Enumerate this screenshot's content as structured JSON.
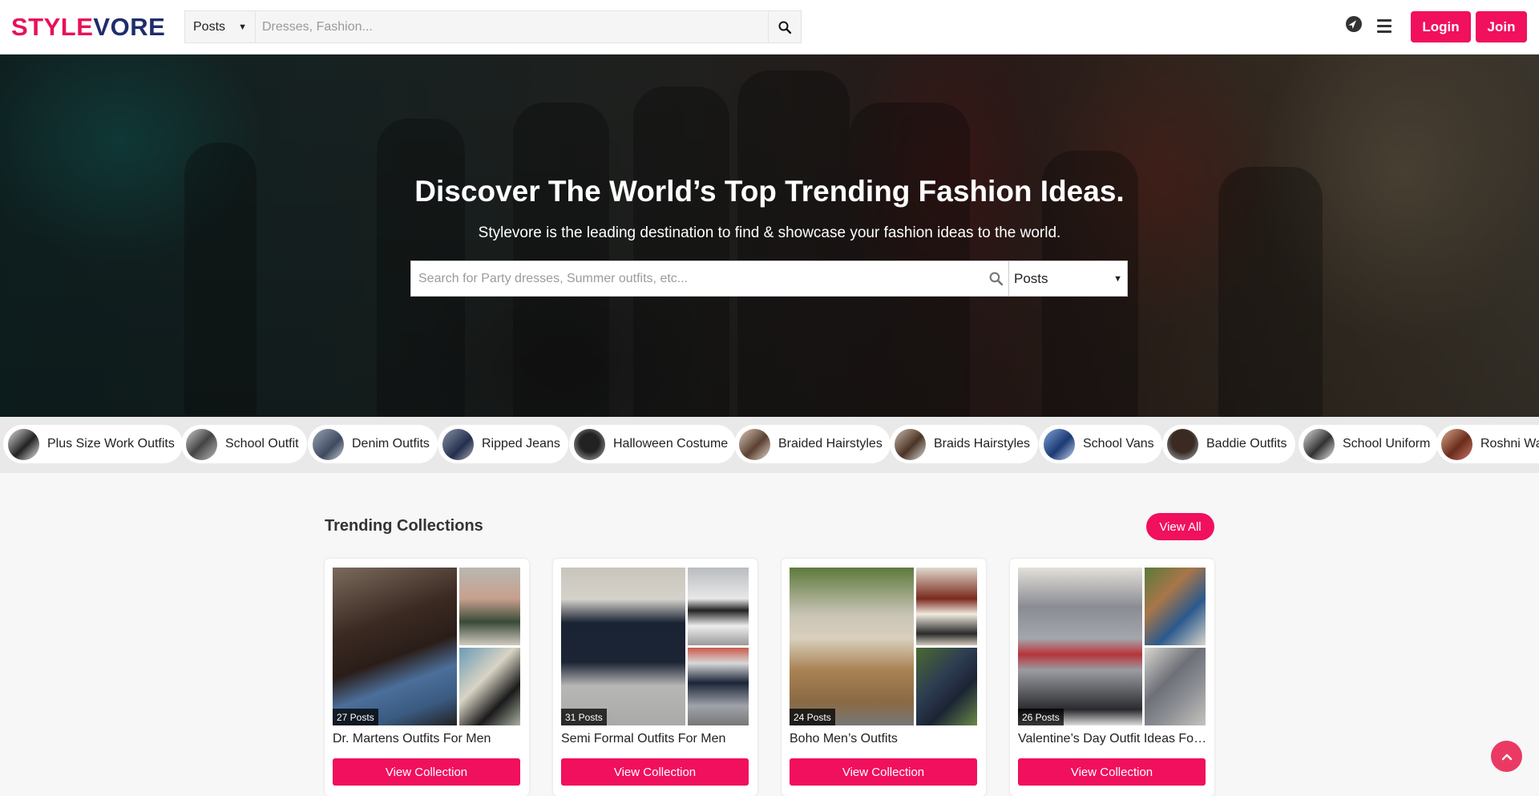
{
  "header": {
    "logo_part1": "STYLE",
    "logo_part2": "VORE",
    "search_type": "Posts",
    "search_placeholder": "Dresses, Fashion...",
    "login_label": "Login",
    "join_label": "Join",
    "icons": [
      "search-icon",
      "compass-icon",
      "hamburger-menu-icon"
    ]
  },
  "hero": {
    "title": "Discover The World’s Top Trending Fashion Ideas.",
    "subtitle": "Stylevore is the leading destination to find & showcase your fashion ideas to the world.",
    "search_placeholder": "Search for Party dresses, Summer outfits, etc...",
    "search_type": "Posts"
  },
  "tags": [
    {
      "label": "Plus Size Work Outfits"
    },
    {
      "label": "School Outfit"
    },
    {
      "label": "Denim Outfits"
    },
    {
      "label": "Ripped Jeans"
    },
    {
      "label": "Halloween Costume"
    },
    {
      "label": "Braided Hairstyles"
    },
    {
      "label": "Braids Hairstyles"
    },
    {
      "label": "School Vans"
    },
    {
      "label": "Baddie Outfits"
    },
    {
      "label": "School Uniform"
    },
    {
      "label": "Roshni Walia"
    }
  ],
  "trending": {
    "title": "Trending Collections",
    "view_all_label": "View All",
    "cards": [
      {
        "title": "Dr. Martens Outfits For Men",
        "posts": "27 Posts",
        "button": "View Collection"
      },
      {
        "title": "Semi Formal Outfits For Men",
        "posts": "31 Posts",
        "button": "View Collection"
      },
      {
        "title": "Boho Men’s Outfits",
        "posts": "24 Posts",
        "button": "View Collection"
      },
      {
        "title": "Valentine’s Day Outfit Ideas For Men",
        "posts": "26 Posts",
        "button": "View Collection"
      }
    ]
  },
  "colors": {
    "accent": "#f0105d",
    "logo_navy": "#1e2d6b"
  }
}
